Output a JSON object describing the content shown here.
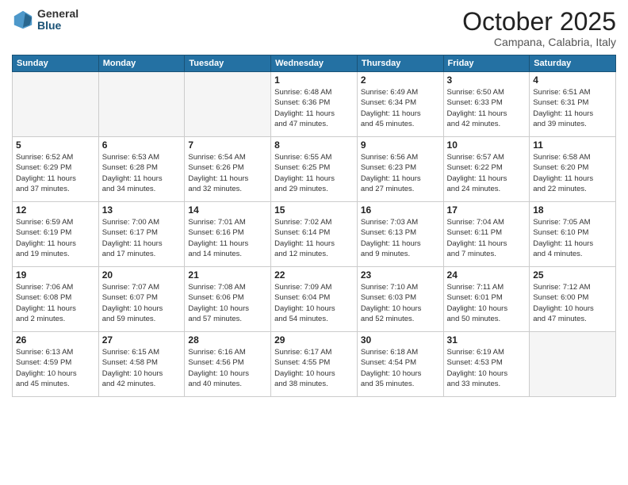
{
  "logo": {
    "general": "General",
    "blue": "Blue"
  },
  "title": "October 2025",
  "subtitle": "Campana, Calabria, Italy",
  "weekdays": [
    "Sunday",
    "Monday",
    "Tuesday",
    "Wednesday",
    "Thursday",
    "Friday",
    "Saturday"
  ],
  "weeks": [
    [
      {
        "day": "",
        "info": ""
      },
      {
        "day": "",
        "info": ""
      },
      {
        "day": "",
        "info": ""
      },
      {
        "day": "1",
        "info": "Sunrise: 6:48 AM\nSunset: 6:36 PM\nDaylight: 11 hours\nand 47 minutes."
      },
      {
        "day": "2",
        "info": "Sunrise: 6:49 AM\nSunset: 6:34 PM\nDaylight: 11 hours\nand 45 minutes."
      },
      {
        "day": "3",
        "info": "Sunrise: 6:50 AM\nSunset: 6:33 PM\nDaylight: 11 hours\nand 42 minutes."
      },
      {
        "day": "4",
        "info": "Sunrise: 6:51 AM\nSunset: 6:31 PM\nDaylight: 11 hours\nand 39 minutes."
      }
    ],
    [
      {
        "day": "5",
        "info": "Sunrise: 6:52 AM\nSunset: 6:29 PM\nDaylight: 11 hours\nand 37 minutes."
      },
      {
        "day": "6",
        "info": "Sunrise: 6:53 AM\nSunset: 6:28 PM\nDaylight: 11 hours\nand 34 minutes."
      },
      {
        "day": "7",
        "info": "Sunrise: 6:54 AM\nSunset: 6:26 PM\nDaylight: 11 hours\nand 32 minutes."
      },
      {
        "day": "8",
        "info": "Sunrise: 6:55 AM\nSunset: 6:25 PM\nDaylight: 11 hours\nand 29 minutes."
      },
      {
        "day": "9",
        "info": "Sunrise: 6:56 AM\nSunset: 6:23 PM\nDaylight: 11 hours\nand 27 minutes."
      },
      {
        "day": "10",
        "info": "Sunrise: 6:57 AM\nSunset: 6:22 PM\nDaylight: 11 hours\nand 24 minutes."
      },
      {
        "day": "11",
        "info": "Sunrise: 6:58 AM\nSunset: 6:20 PM\nDaylight: 11 hours\nand 22 minutes."
      }
    ],
    [
      {
        "day": "12",
        "info": "Sunrise: 6:59 AM\nSunset: 6:19 PM\nDaylight: 11 hours\nand 19 minutes."
      },
      {
        "day": "13",
        "info": "Sunrise: 7:00 AM\nSunset: 6:17 PM\nDaylight: 11 hours\nand 17 minutes."
      },
      {
        "day": "14",
        "info": "Sunrise: 7:01 AM\nSunset: 6:16 PM\nDaylight: 11 hours\nand 14 minutes."
      },
      {
        "day": "15",
        "info": "Sunrise: 7:02 AM\nSunset: 6:14 PM\nDaylight: 11 hours\nand 12 minutes."
      },
      {
        "day": "16",
        "info": "Sunrise: 7:03 AM\nSunset: 6:13 PM\nDaylight: 11 hours\nand 9 minutes."
      },
      {
        "day": "17",
        "info": "Sunrise: 7:04 AM\nSunset: 6:11 PM\nDaylight: 11 hours\nand 7 minutes."
      },
      {
        "day": "18",
        "info": "Sunrise: 7:05 AM\nSunset: 6:10 PM\nDaylight: 11 hours\nand 4 minutes."
      }
    ],
    [
      {
        "day": "19",
        "info": "Sunrise: 7:06 AM\nSunset: 6:08 PM\nDaylight: 11 hours\nand 2 minutes."
      },
      {
        "day": "20",
        "info": "Sunrise: 7:07 AM\nSunset: 6:07 PM\nDaylight: 10 hours\nand 59 minutes."
      },
      {
        "day": "21",
        "info": "Sunrise: 7:08 AM\nSunset: 6:06 PM\nDaylight: 10 hours\nand 57 minutes."
      },
      {
        "day": "22",
        "info": "Sunrise: 7:09 AM\nSunset: 6:04 PM\nDaylight: 10 hours\nand 54 minutes."
      },
      {
        "day": "23",
        "info": "Sunrise: 7:10 AM\nSunset: 6:03 PM\nDaylight: 10 hours\nand 52 minutes."
      },
      {
        "day": "24",
        "info": "Sunrise: 7:11 AM\nSunset: 6:01 PM\nDaylight: 10 hours\nand 50 minutes."
      },
      {
        "day": "25",
        "info": "Sunrise: 7:12 AM\nSunset: 6:00 PM\nDaylight: 10 hours\nand 47 minutes."
      }
    ],
    [
      {
        "day": "26",
        "info": "Sunrise: 6:13 AM\nSunset: 4:59 PM\nDaylight: 10 hours\nand 45 minutes."
      },
      {
        "day": "27",
        "info": "Sunrise: 6:15 AM\nSunset: 4:58 PM\nDaylight: 10 hours\nand 42 minutes."
      },
      {
        "day": "28",
        "info": "Sunrise: 6:16 AM\nSunset: 4:56 PM\nDaylight: 10 hours\nand 40 minutes."
      },
      {
        "day": "29",
        "info": "Sunrise: 6:17 AM\nSunset: 4:55 PM\nDaylight: 10 hours\nand 38 minutes."
      },
      {
        "day": "30",
        "info": "Sunrise: 6:18 AM\nSunset: 4:54 PM\nDaylight: 10 hours\nand 35 minutes."
      },
      {
        "day": "31",
        "info": "Sunrise: 6:19 AM\nSunset: 4:53 PM\nDaylight: 10 hours\nand 33 minutes."
      },
      {
        "day": "",
        "info": ""
      }
    ]
  ]
}
